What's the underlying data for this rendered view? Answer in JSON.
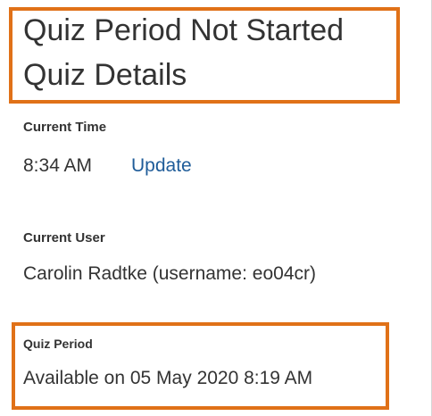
{
  "header": {
    "status_title": "Quiz Period Not Started",
    "details_title": "Quiz Details"
  },
  "current_time": {
    "label": "Current Time",
    "value": "8:34 AM",
    "update_label": "Update"
  },
  "current_user": {
    "label": "Current User",
    "value": "Carolin Radtke (username: eo04cr)"
  },
  "quiz_period": {
    "label": "Quiz Period",
    "value": "Available on 05 May 2020 8:19 AM"
  },
  "colors": {
    "highlight": "#e07118",
    "link": "#1f5c99",
    "text": "#333333"
  }
}
